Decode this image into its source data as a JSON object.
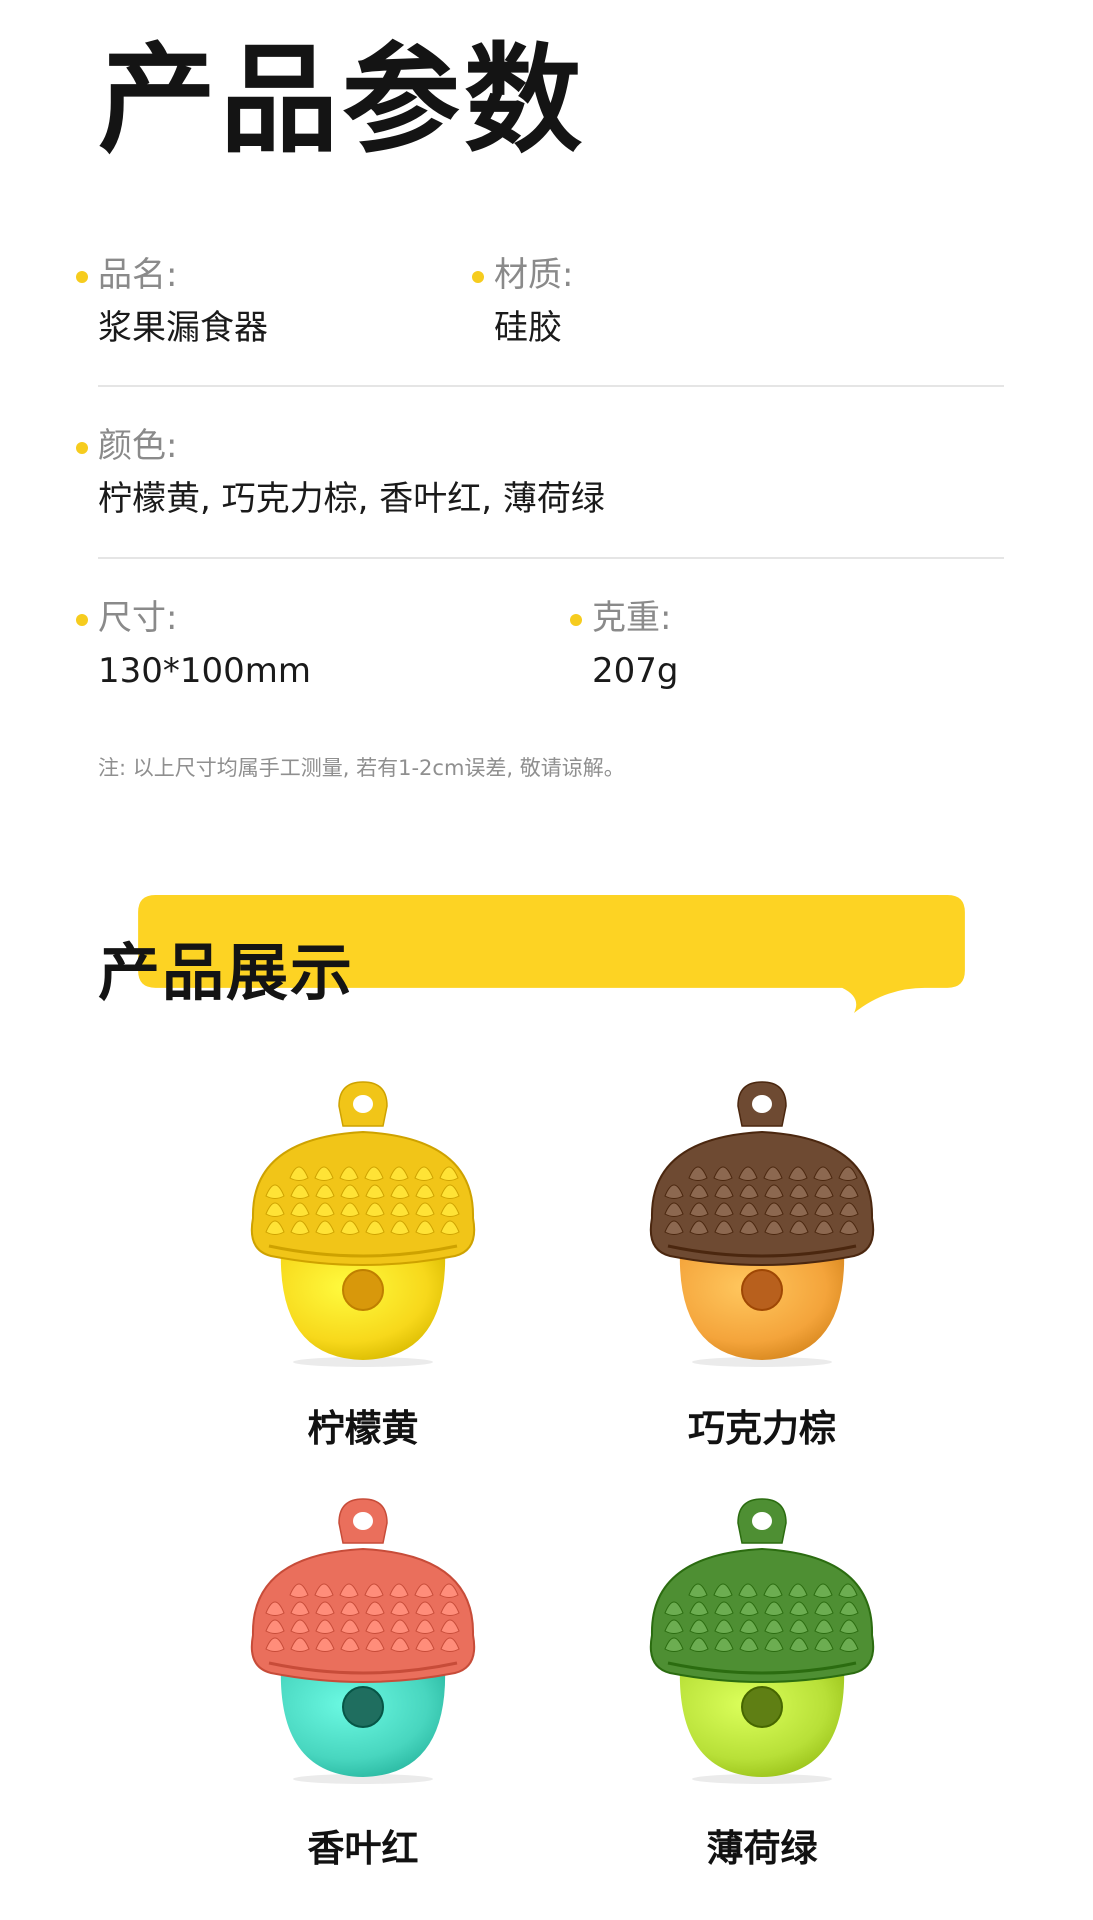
{
  "header": {
    "title": "产品参数"
  },
  "params": {
    "name": {
      "label": "品名:",
      "value": "浆果漏食器"
    },
    "material": {
      "label": "材质:",
      "value": "硅胶"
    },
    "color": {
      "label": "颜色:",
      "value": "柠檬黄, 巧克力棕, 香叶红, 薄荷绿"
    },
    "size": {
      "label": "尺寸:",
      "value": "130*100mm"
    },
    "weight": {
      "label": "克重:",
      "value": "207g"
    },
    "note": "注: 以上尺寸均属手工测量, 若有1-2cm误差, 敬请谅解。"
  },
  "showcase": {
    "title": "产品展示",
    "accent_color": "#fdd323",
    "products": [
      {
        "name": "柠檬黄",
        "cap_color": "#f1c518",
        "body_color": "#f7d81b",
        "hole_color": "#d8980b",
        "icon": "acorn-feeder-icon"
      },
      {
        "name": "巧克力棕",
        "cap_color": "#6e4a32",
        "body_color": "#f4a43b",
        "hole_color": "#b8601d",
        "icon": "acorn-feeder-icon"
      },
      {
        "name": "香叶红",
        "cap_color": "#ea6f5c",
        "body_color": "#48d6bf",
        "hole_color": "#1f6e5f",
        "icon": "acorn-feeder-icon"
      },
      {
        "name": "薄荷绿",
        "cap_color": "#4e8f33",
        "body_color": "#b8e038",
        "hole_color": "#5f7f14",
        "icon": "acorn-feeder-icon"
      }
    ]
  }
}
